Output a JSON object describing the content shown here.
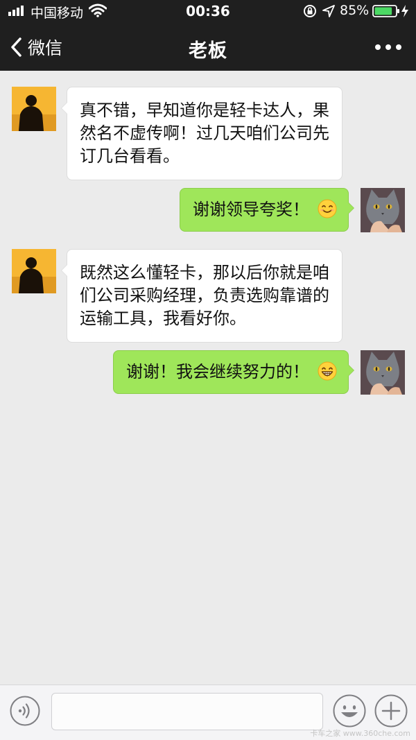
{
  "status_bar": {
    "carrier": "中国移动",
    "time": "00:36",
    "battery_percent": "85%",
    "battery_level": 0.85,
    "icons": [
      "signal-icon",
      "wifi-icon",
      "rotation-lock-icon",
      "location-icon",
      "battery-icon",
      "charging-icon"
    ]
  },
  "nav": {
    "back_label": "微信",
    "title": "老板",
    "more_icon": "more-dots-icon"
  },
  "messages": [
    {
      "side": "left",
      "sender": "boss",
      "text": "真不错，早知道你是轻卡达人，果然名不虚传啊！过几天咱们公司先订几台看看。"
    },
    {
      "side": "right",
      "sender": "me",
      "text": "谢谢领导夸奖！",
      "emoji": "smiling-face-emoji"
    },
    {
      "side": "left",
      "sender": "boss",
      "text": "既然这么懂轻卡，那以后你就是咱们公司采购经理，负责选购靠谱的运输工具，我看好你。"
    },
    {
      "side": "right",
      "sender": "me",
      "text": "谢谢！我会继续努力的！",
      "emoji": "grinning-face-emoji"
    }
  ],
  "input_bar": {
    "value": "",
    "icons": [
      "voice-icon",
      "emoji-icon",
      "plus-icon"
    ]
  },
  "watermark": "卡车之家 www.360che.com",
  "colors": {
    "nav_bg": "#1f1f1f",
    "chat_bg": "#ebebeb",
    "bubble_out": "#9fe65a",
    "bubble_in": "#ffffff"
  }
}
